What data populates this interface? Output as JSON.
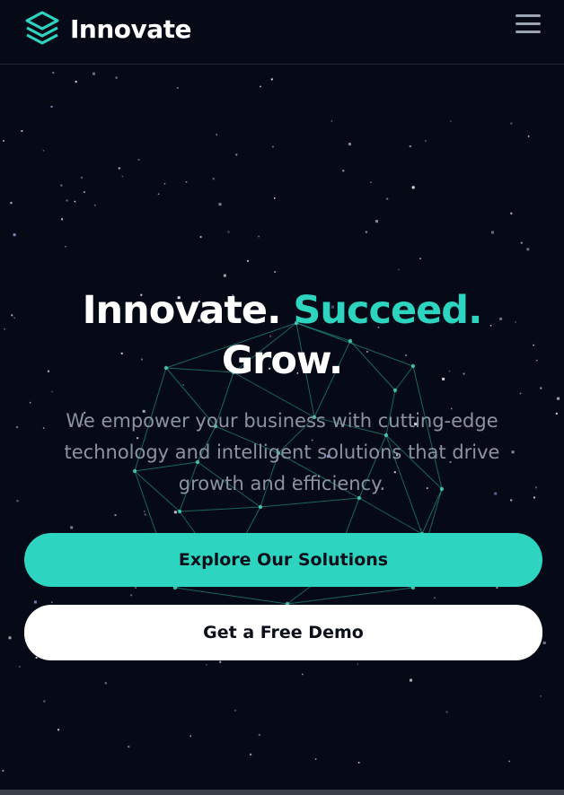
{
  "header": {
    "brand": "Innovate",
    "menu_icon": "hamburger-menu-icon",
    "logo_icon": "stacked-layers-icon"
  },
  "hero": {
    "headline_part1": "Innovate.",
    "headline_part2": "Succeed.",
    "headline_part3": "Grow.",
    "subtext": "We empower your business with cutting-edge technology and intelligent solutions that drive growth and efficiency."
  },
  "buttons": {
    "primary_label": "Explore Our Solutions",
    "secondary_label": "Get a Free Demo"
  },
  "colors": {
    "background": "#060a16",
    "accent": "#2dd4bf",
    "text_primary": "#ffffff",
    "text_muted": "#8c93a2"
  }
}
